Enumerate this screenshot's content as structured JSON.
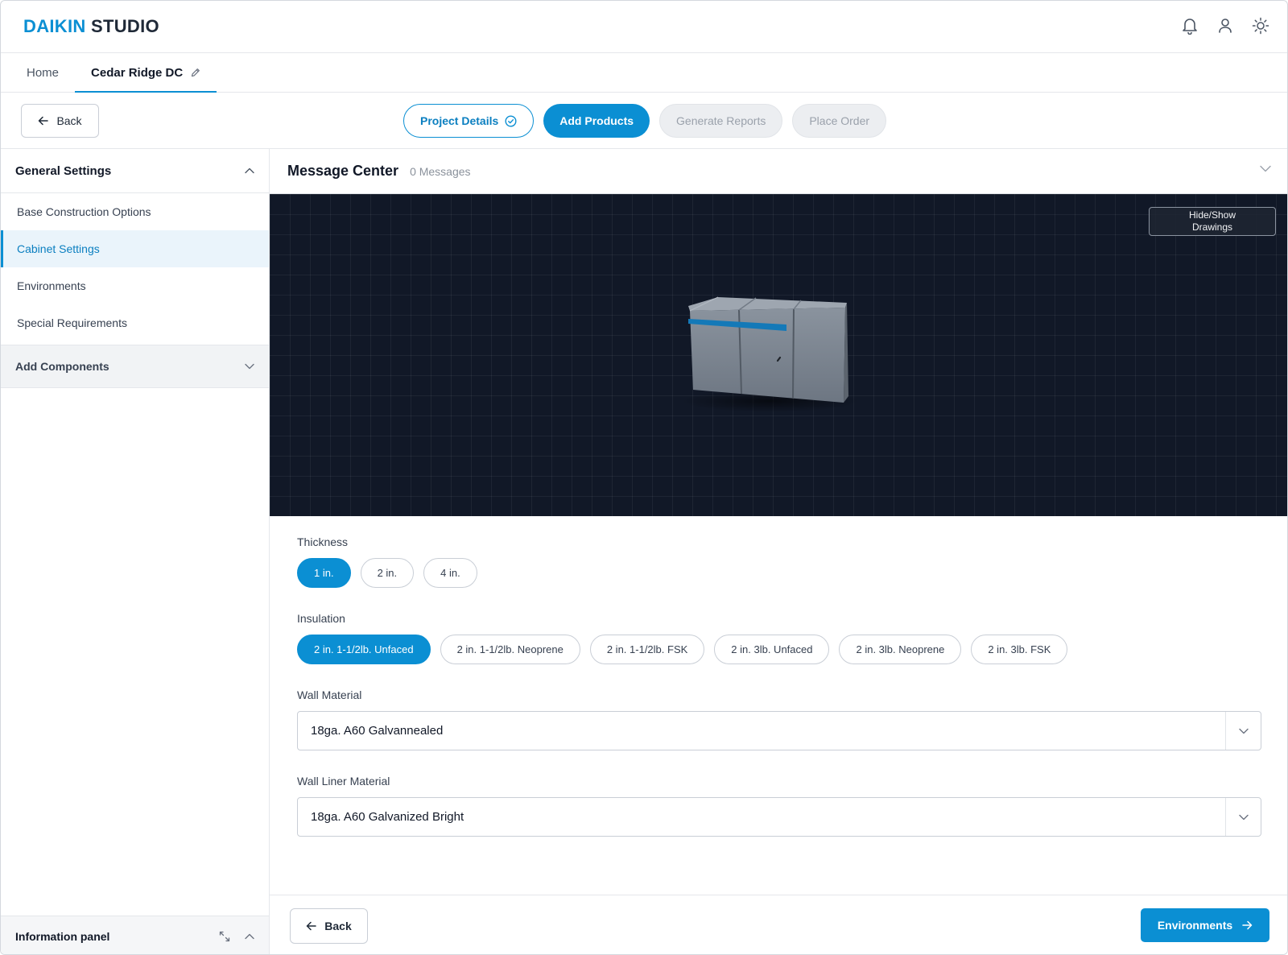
{
  "header": {
    "brand_part1": "DAIKIN",
    "brand_part2": "STUDIO",
    "icons": [
      "bell-icon",
      "user-icon",
      "sun-icon"
    ]
  },
  "tabs": [
    {
      "label": "Home",
      "active": false
    },
    {
      "label": "Cedar Ridge DC",
      "active": true,
      "icon": "pencil-icon"
    }
  ],
  "stepbar": {
    "back_label": "Back",
    "steps": [
      {
        "label": "Project Details",
        "state": "done"
      },
      {
        "label": "Add Products",
        "state": "current"
      },
      {
        "label": "Generate Reports",
        "state": "disabled"
      },
      {
        "label": "Place Order",
        "state": "disabled"
      }
    ]
  },
  "sidebar": {
    "section_title": "General Settings",
    "items": [
      {
        "label": "Base Construction Options",
        "active": false
      },
      {
        "label": "Cabinet Settings",
        "active": true
      },
      {
        "label": "Environments",
        "active": false
      },
      {
        "label": "Special Requirements",
        "active": false
      }
    ],
    "group_title": "Add Components",
    "info_panel_title": "Information panel"
  },
  "message_center": {
    "title": "Message Center",
    "count_label": "0 Messages"
  },
  "viewer": {
    "toggle_line1": "Hide/Show",
    "toggle_line2": "Drawings"
  },
  "form": {
    "thickness": {
      "label": "Thickness",
      "options": [
        "1 in.",
        "2 in.",
        "4 in."
      ],
      "selected": "1 in."
    },
    "insulation": {
      "label": "Insulation",
      "options": [
        "2 in. 1-1/2lb. Unfaced",
        "2 in. 1-1/2lb. Neoprene",
        "2 in. 1-1/2lb. FSK",
        "2 in. 3lb. Unfaced",
        "2 in. 3lb. Neoprene",
        "2 in. 3lb. FSK"
      ],
      "selected": "2 in. 1-1/2lb. Unfaced"
    },
    "wall_material": {
      "label": "Wall Material",
      "value": "18ga. A60 Galvannealed"
    },
    "wall_liner_material": {
      "label": "Wall Liner Material",
      "value": "18ga. A60 Galvanized Bright"
    }
  },
  "footer": {
    "back_label": "Back",
    "next_label": "Environments"
  },
  "colors": {
    "accent": "#0b8fd3",
    "viewer_bg": "#111827",
    "accent_band": "#1479b8"
  }
}
